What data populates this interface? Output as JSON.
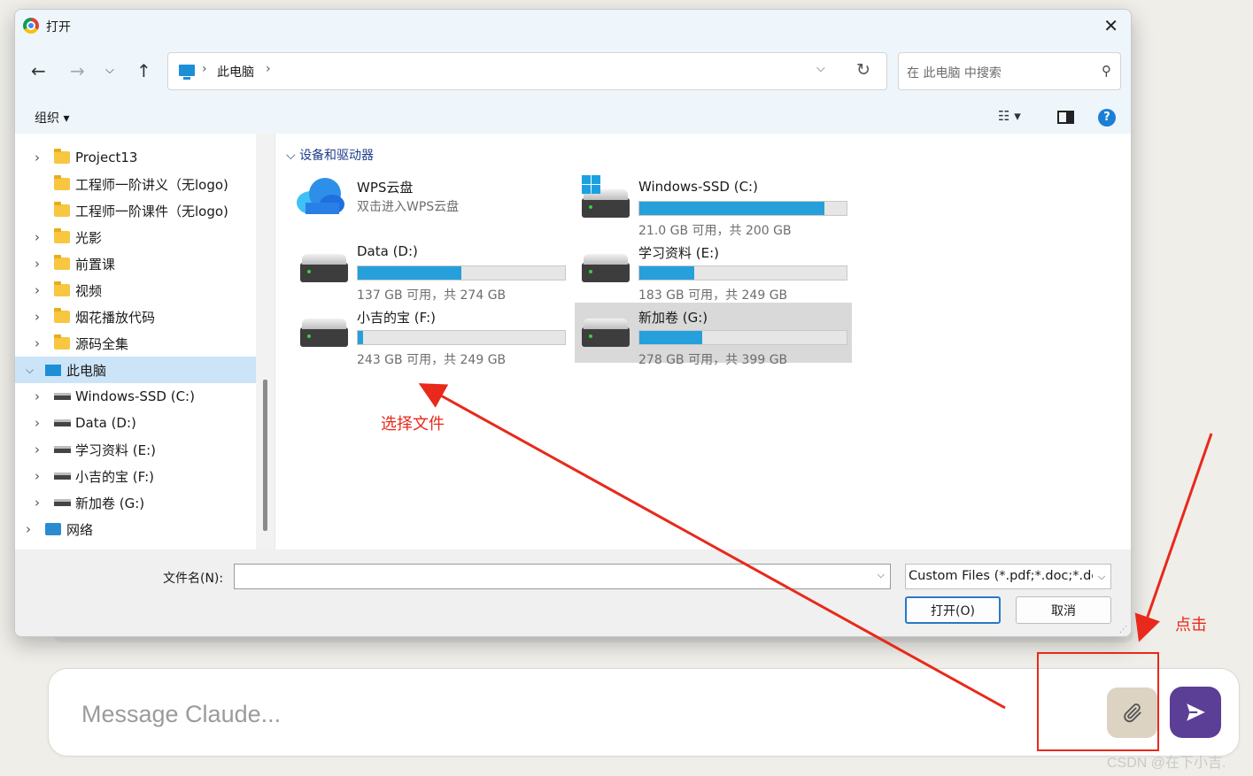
{
  "composer": {
    "placeholder": "Message Claude..."
  },
  "watermark": "CSDN @在下小吉.",
  "annotations": {
    "select_file": "选择文件",
    "click": "点击",
    "color": "#e8291b"
  },
  "dialog": {
    "title": "打开",
    "address": {
      "crumb": "此电脑"
    },
    "search_placeholder": "在 此电脑 中搜索",
    "organize_label": "组织 ▾",
    "sidebar": [
      {
        "label": "Project13",
        "icon": "folder-icon",
        "expandable": true
      },
      {
        "label": "工程师一阶讲义（无logo)",
        "icon": "folder-icon",
        "expandable": false
      },
      {
        "label": "工程师一阶课件（无logo)",
        "icon": "folder-icon",
        "expandable": false
      },
      {
        "label": "光影",
        "icon": "folder-icon",
        "expandable": true
      },
      {
        "label": "前置课",
        "icon": "folder-icon",
        "expandable": true
      },
      {
        "label": "视频",
        "icon": "folder-icon",
        "expandable": true
      },
      {
        "label": "烟花播放代码",
        "icon": "folder-icon",
        "expandable": true
      },
      {
        "label": "源码全集",
        "icon": "folder-icon",
        "expandable": true
      },
      {
        "label": "此电脑",
        "icon": "computer-icon",
        "expanded": true,
        "selected": true
      },
      {
        "label": "Windows-SSD (C:)",
        "icon": "drive-icon",
        "expandable": true
      },
      {
        "label": "Data (D:)",
        "icon": "drive-icon",
        "expandable": true
      },
      {
        "label": "学习资料 (E:)",
        "icon": "drive-icon",
        "expandable": true
      },
      {
        "label": "小吉的宝 (F:)",
        "icon": "drive-icon",
        "expandable": true
      },
      {
        "label": "新加卷 (G:)",
        "icon": "drive-icon",
        "expandable": true
      },
      {
        "label": "网络",
        "icon": "network-icon",
        "expandable": true
      }
    ],
    "group_header": "设备和驱动器",
    "cloud": {
      "name": "WPS云盘",
      "subtitle": "双击进入WPS云盘"
    },
    "drives": [
      {
        "name": "Windows-SSD (C:)",
        "usage": "21.0 GB 可用，共 200 GB",
        "used_fraction": 0.895,
        "windows": true
      },
      {
        "name": "Data (D:)",
        "usage": "137 GB 可用，共 274 GB",
        "used_fraction": 0.5
      },
      {
        "name": "学习资料 (E:)",
        "usage": "183 GB 可用，共 249 GB",
        "used_fraction": 0.265
      },
      {
        "name": "小吉的宝 (F:)",
        "usage": "243 GB 可用，共 249 GB",
        "used_fraction": 0.024
      },
      {
        "name": "新加卷 (G:)",
        "usage": "278 GB 可用，共 399 GB",
        "used_fraction": 0.303,
        "selected": true
      }
    ],
    "filename_label": "文件名(N):",
    "filename_value": "",
    "filter_label": "Custom Files (*.pdf;*.doc;*.docx)",
    "open_label": "打开(O)",
    "cancel_label": "取消"
  },
  "colors": {
    "accent": "#26a0da",
    "send": "#5b3e96",
    "attach": "#dcd3c3"
  }
}
